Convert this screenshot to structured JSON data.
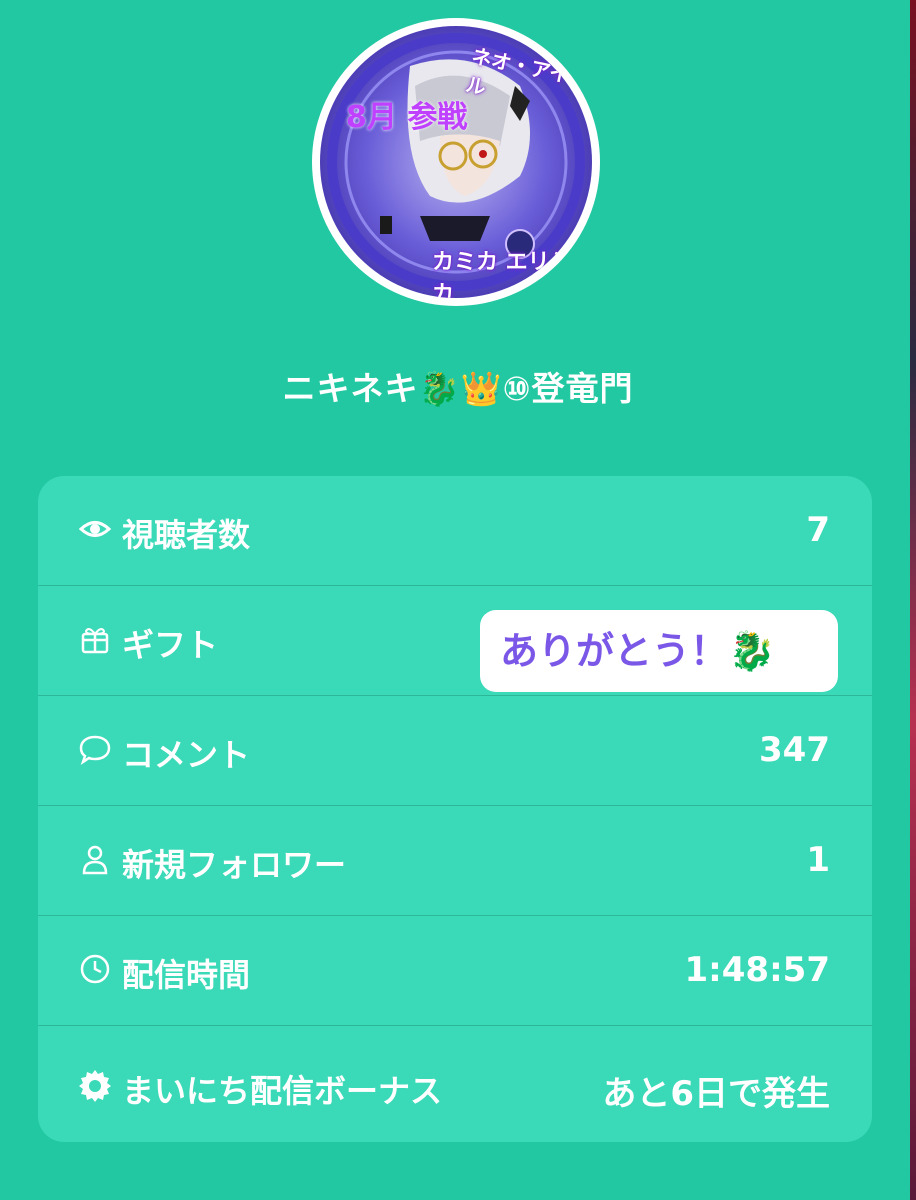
{
  "profile": {
    "avatar_alt": "profile-avatar",
    "avatar_text_top": "ネオ・アイドル",
    "avatar_text_left": "8月 参戦",
    "avatar_text_bottom": "カミカ エリミカ",
    "username": "ニキネキ🐉👑⑩登竜門"
  },
  "stats": {
    "viewers_label": "視聴者数",
    "viewers_value": "7",
    "gift_label": "ギフト",
    "gift_value": "ありがとう！🐉",
    "comments_label": "コメント",
    "comments_value": "347",
    "followers_label": "新規フォロワー",
    "followers_value": "1",
    "duration_label": "配信時間",
    "duration_value": "1:48:57",
    "bonus_label": "まいにち配信ボーナス",
    "bonus_value": "あと6日で発生"
  },
  "colors": {
    "background": "#22c8a1",
    "card": "#3ad9b8",
    "gift_text": "#7b57e8",
    "text": "#ffffff"
  },
  "icons": {
    "viewers": "eye-icon",
    "gift": "gift-icon",
    "comments": "speech-bubble-icon",
    "followers": "person-icon",
    "duration": "clock-icon",
    "bonus": "gear-badge-icon"
  }
}
